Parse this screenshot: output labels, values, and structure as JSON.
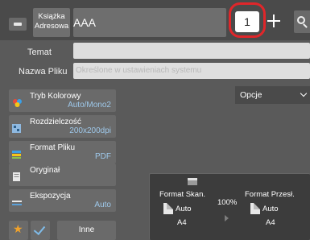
{
  "topbar": {
    "address_book_label": "Książka Adresowa",
    "destination": "AAA",
    "copies": "1"
  },
  "fields": {
    "subject_label": "Temat",
    "subject_value": "",
    "filename_label": "Nazwa Pliku",
    "filename_placeholder": "Określone w ustawieniach systemu"
  },
  "settings": [
    {
      "label": "Tryb Kolorowy",
      "value": "Auto/Mono2",
      "icon": "color-mode-icon"
    },
    {
      "label": "Rozdzielczość",
      "value": "200x200dpi",
      "icon": "resolution-icon"
    },
    {
      "label": "Format Pliku",
      "value": "PDF",
      "icon": "file-format-icon"
    },
    {
      "label": "Oryginał",
      "value": "",
      "icon": "original-icon"
    },
    {
      "label": "Ekspozycja",
      "value": "Auto",
      "icon": "exposure-icon"
    }
  ],
  "options_label": "Opcje",
  "preview": {
    "scan_size_label": "Format Skan.",
    "scan_size_value": "Auto",
    "scan_paper": "A4",
    "ratio": "100%",
    "send_size_label": "Format Przesł.",
    "send_size_value": "Auto",
    "send_paper": "A4"
  },
  "bottom": {
    "other_label": "Inne"
  },
  "colors": {
    "accent_value": "#9ec8ea",
    "highlight_ring": "#e0262a",
    "star": "#f0a22b"
  }
}
